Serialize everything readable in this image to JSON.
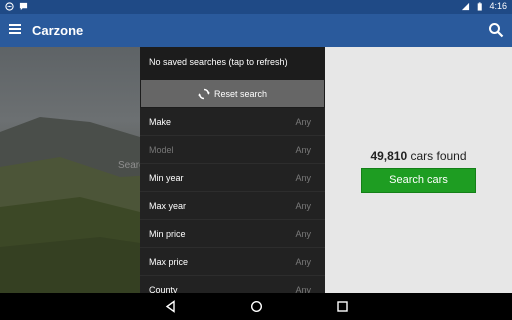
{
  "status_bar": {
    "time": "4:16"
  },
  "app_bar": {
    "title": "Carzone"
  },
  "hero": {
    "search_hint": "Searc"
  },
  "panel": {
    "saved_searches": "No saved searches (tap to refresh)",
    "reset_label": "Reset search",
    "rows": [
      {
        "label": "Make",
        "value": "Any",
        "disabled": false
      },
      {
        "label": "Model",
        "value": "Any",
        "disabled": true
      },
      {
        "label": "Min year",
        "value": "Any",
        "disabled": false
      },
      {
        "label": "Max year",
        "value": "Any",
        "disabled": false
      },
      {
        "label": "Min price",
        "value": "Any",
        "disabled": false
      },
      {
        "label": "Max price",
        "value": "Any",
        "disabled": false
      },
      {
        "label": "County",
        "value": "Any",
        "disabled": false
      }
    ]
  },
  "results": {
    "count": "49,810",
    "suffix": " cars found",
    "button_label": "Search cars"
  },
  "colors": {
    "status_bar": "#1f4a86",
    "app_bar": "#2a5a9c",
    "accent_green": "#1e9d22",
    "panel_bg": "#1c1c1c"
  },
  "icons": [
    "chat-icon",
    "message-icon",
    "signal-icon",
    "battery-icon",
    "menu-icon",
    "search-icon",
    "refresh-icon",
    "back-icon",
    "home-icon",
    "recents-icon"
  ]
}
